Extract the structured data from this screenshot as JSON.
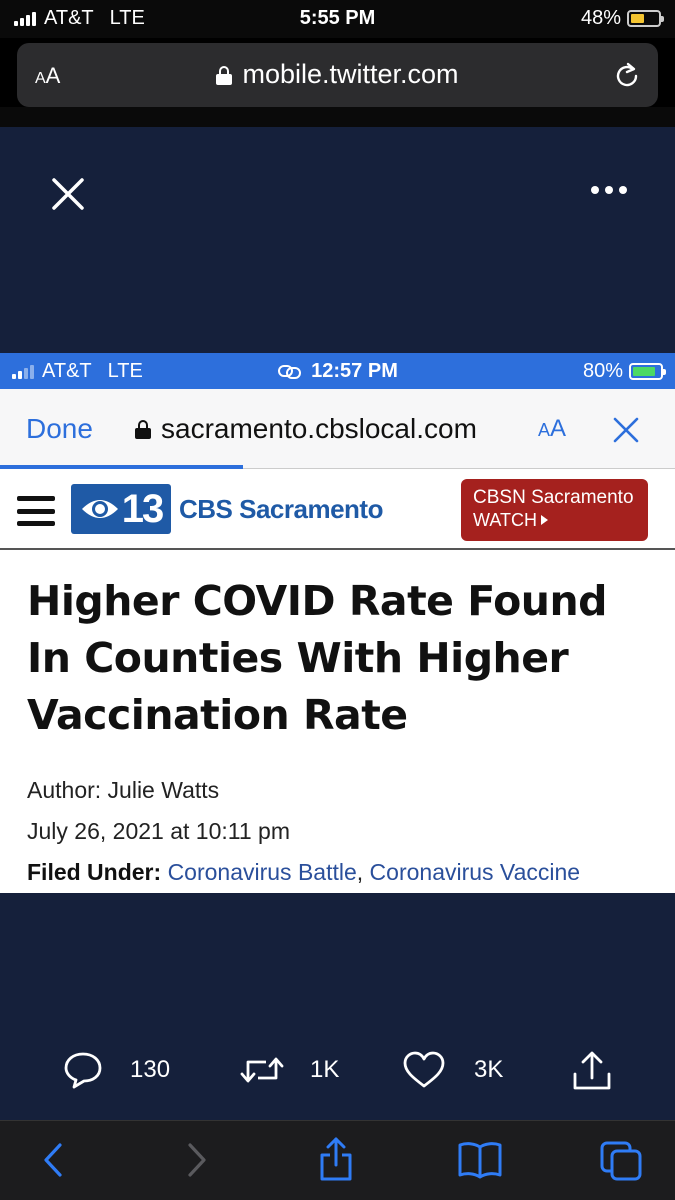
{
  "outer_status": {
    "carrier": "AT&T",
    "network": "LTE",
    "time": "5:55 PM",
    "battery": "48%",
    "battery_level": 0.48,
    "battery_color": "#f4c430"
  },
  "outer_url_bar": {
    "text_size_label": "AA",
    "url": "mobile.twitter.com",
    "reload_icon": "reload-icon"
  },
  "media_viewer": {
    "background": "#15203b",
    "close_icon": "close-icon",
    "more_icon": "more-icon"
  },
  "screenshot": {
    "status": {
      "carrier": "AT&T",
      "network": "LTE",
      "time": "12:57 PM",
      "battery": "80%",
      "battery_level": 0.8,
      "bar_color": "#2d6fdc"
    },
    "browser": {
      "done_label": "Done",
      "url": "sacramento.cbslocal.com",
      "text_size_label": "AA"
    },
    "site": {
      "logo_number": "13",
      "logo_name": "CBS Sacramento",
      "cbsn_line1": "CBSN Sacramento",
      "cbsn_line2": "WATCH",
      "cbsn_color": "#a5211e"
    },
    "article": {
      "headline": "Higher COVID Rate Found In Counties With Higher Vaccination Rate",
      "author": "Author: Julie Watts",
      "date": "July 26, 2021 at 10:11 pm",
      "filed_label": "Filed Under:",
      "categories": [
        "Coronavirus Battle",
        "Coronavirus Vaccine"
      ],
      "separator": ", "
    }
  },
  "tweet_actions": {
    "replies": "130",
    "retweets": "1K",
    "likes": "3K"
  },
  "safari_toolbar": {
    "items": [
      "back-icon",
      "forward-icon",
      "share-icon",
      "bookmarks-icon",
      "tabs-icon"
    ]
  }
}
